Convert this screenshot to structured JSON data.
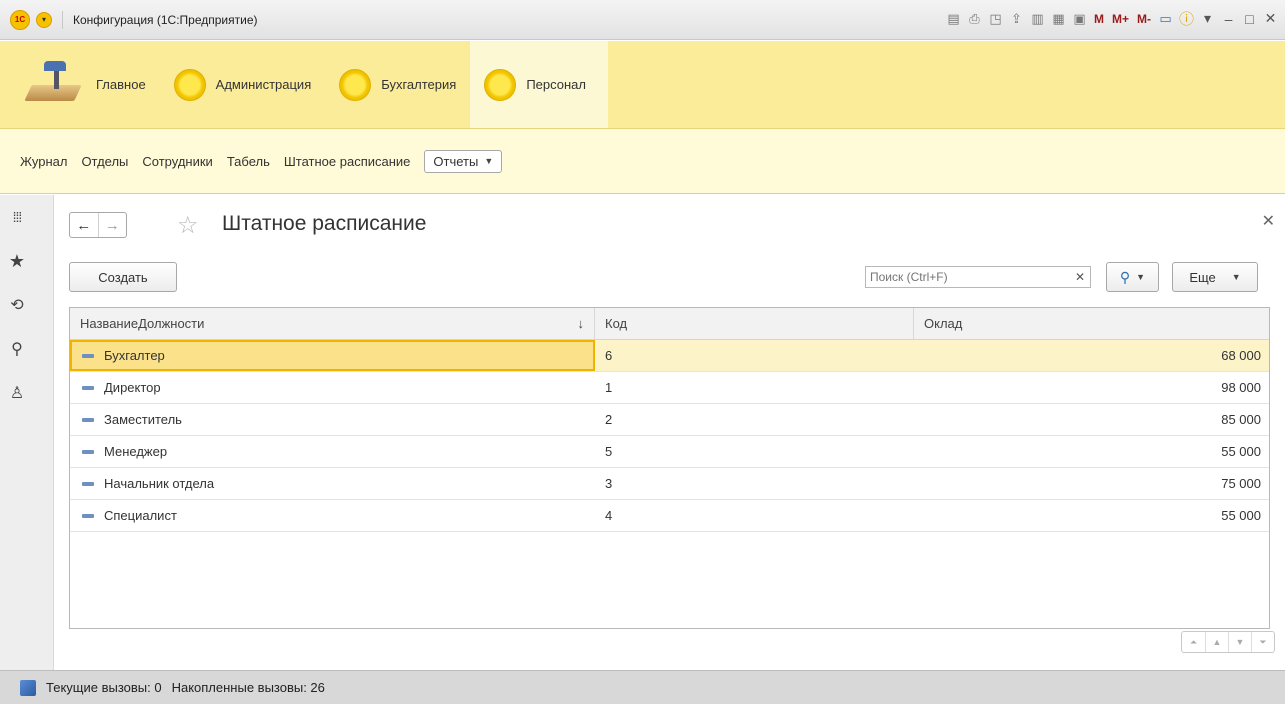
{
  "window": {
    "title": "Конфигурация (1С:Предприятие)",
    "tools": [
      "save-icon",
      "print-icon",
      "preview-icon",
      "upload-icon",
      "print-dialog-icon",
      "calculator-icon",
      "calendar-icon"
    ],
    "m_labels": [
      "M",
      "M+",
      "M-"
    ],
    "controls": [
      "minimize",
      "restore",
      "close"
    ]
  },
  "sections": [
    {
      "label": "Главное",
      "icon": "desk-lamp-icon",
      "active": false
    },
    {
      "label": "Администрация",
      "icon": "coin-icon",
      "active": false
    },
    {
      "label": "Бухгалтерия",
      "icon": "coin-icon",
      "active": false
    },
    {
      "label": "Персонал",
      "icon": "coin-icon",
      "active": true
    }
  ],
  "nav": {
    "links": [
      "Журнал",
      "Отделы",
      "Сотрудники",
      "Табель",
      "Штатное расписание"
    ],
    "reports_label": "Отчеты"
  },
  "left_panel": [
    "apps-grid-icon",
    "favorites-star-icon",
    "history-icon",
    "search-icon",
    "notifications-bell-icon"
  ],
  "form": {
    "title": "Штатное расписание",
    "create_label": "Создать",
    "search_placeholder": "Поиск (Ctrl+F)",
    "search_value": "",
    "more_label": "Еще"
  },
  "table": {
    "columns": [
      "НазваниеДолжности",
      "Код",
      "Оклад"
    ],
    "sort_indicator": "↓",
    "rows": [
      {
        "name": "Бухгалтер",
        "code": "6",
        "salary": "68 000",
        "selected": true
      },
      {
        "name": "Директор",
        "code": "1",
        "salary": "98 000",
        "selected": false
      },
      {
        "name": "Заместитель",
        "code": "2",
        "salary": "85 000",
        "selected": false
      },
      {
        "name": "Менеджер",
        "code": "5",
        "salary": "55 000",
        "selected": false
      },
      {
        "name": "Начальник отдела",
        "code": "3",
        "salary": "75 000",
        "selected": false
      },
      {
        "name": "Специалист",
        "code": "4",
        "salary": "55 000",
        "selected": false
      }
    ]
  },
  "status": {
    "current_calls": "Текущие вызовы: 0",
    "accumulated_calls": "Накопленные вызовы: 26"
  },
  "colors": {
    "sections_bg": "#fbec9a",
    "nav_bg": "#fffbd9",
    "selected_row": "#fdf3c9",
    "selected_cell_border": "#f0b400"
  }
}
